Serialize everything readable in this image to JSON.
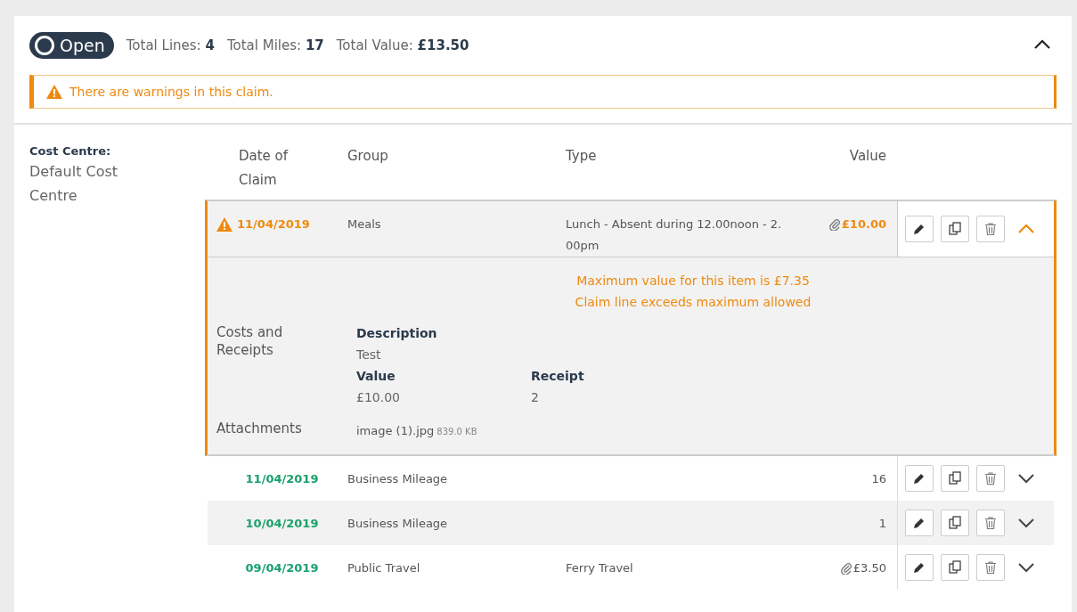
{
  "status": {
    "label": "Open"
  },
  "totals": [
    {
      "label": "Total Lines:",
      "value": "4"
    },
    {
      "label": "Total Miles:",
      "value": "17"
    },
    {
      "label": "Total Value:",
      "value": "£13.50"
    }
  ],
  "panel": {
    "expanded": true
  },
  "warning_banner": {
    "text": "There are warnings in this claim."
  },
  "cost_centre": {
    "label": "Cost Centre:",
    "value": "Default Cost Centre"
  },
  "table": {
    "columns": [
      "Date of Claim",
      "Group",
      "Type",
      "Value"
    ],
    "rows": [
      {
        "date": "11/04/2019",
        "group": "Meals",
        "type": "Lunch - Absent during 12.00noon - 2.00pm",
        "value": "£10.00",
        "warning": true,
        "attachment": true,
        "expanded": true,
        "details": {
          "messages": [
            "Maximum value for this item is £7.35",
            "Claim line exceeds maximum allowed"
          ],
          "costs_label": "Costs and Receipts",
          "description_label": "Description",
          "description": "Test",
          "value_label": "Value",
          "value": "£10.00",
          "receipt_label": "Receipt",
          "receipt": "2",
          "attachments_label": "Attachments",
          "file_name": "image (1).jpg",
          "file_size": "839.0 KB"
        }
      },
      {
        "date": "11/04/2019",
        "group": "Business Mileage",
        "value": "16",
        "warning": false,
        "attachment": false,
        "expanded": false
      },
      {
        "date": "10/04/2019",
        "group": "Business Mileage",
        "value": "1",
        "warning": false,
        "attachment": false,
        "expanded": false
      },
      {
        "date": "09/04/2019",
        "group": "Public Travel",
        "type": "Ferry Travel",
        "value": "£3.50",
        "warning": false,
        "attachment": true,
        "expanded": false
      }
    ]
  }
}
